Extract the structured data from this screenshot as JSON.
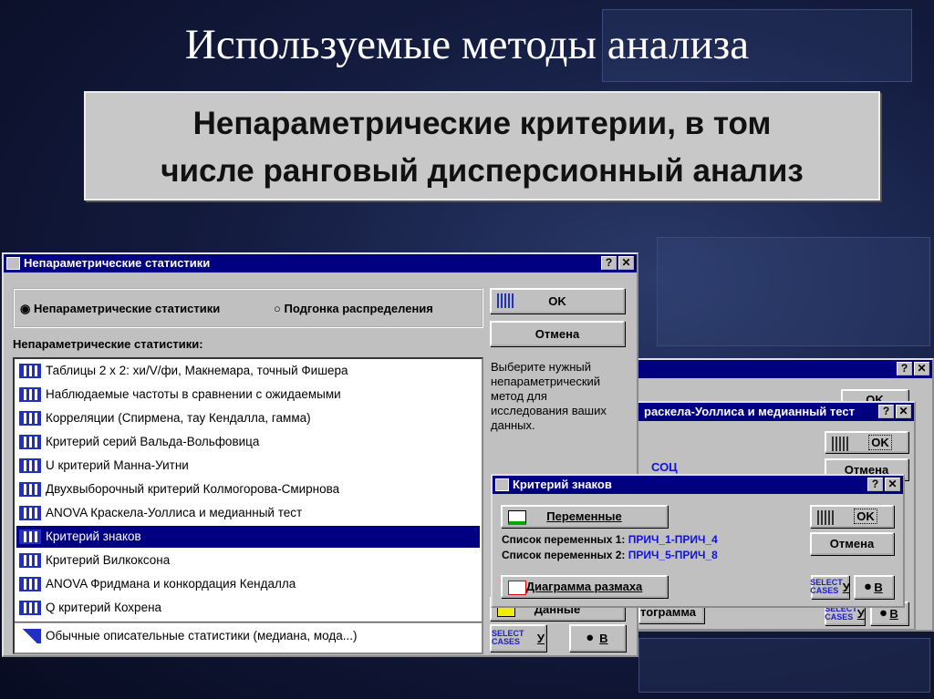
{
  "slide": {
    "title": "Используемые методы анализа",
    "subtitle_line1": "Непараметрические критерии, в том",
    "subtitle_line2": "числе ранговый дисперсионный анализ"
  },
  "main_dialog": {
    "title": "Непараметрические статистики",
    "radio_options": [
      {
        "label": "Непараметрические статистики",
        "selected": true
      },
      {
        "label": "Подгонка распределения",
        "selected": false
      }
    ],
    "list_label": "Непараметрические статистики:",
    "items": [
      "Таблицы 2 x 2:  хи/V/фи, Макнемара, точный Фишера",
      "Наблюдаемые частоты в сравнении с ожидаемыми",
      "Корреляции (Спирмена, тау Кендалла, гамма)",
      "Критерий серий Вальда-Вольфовица",
      "U критерий Манна-Уитни",
      "Двухвыборочный критерий Колмогорова-Смирнова",
      "ANOVA Краскела-Уоллиса и медианный тест",
      "Критерий знаков",
      "Критерий Вилкоксона",
      "ANOVA Фридмана и конкордация Кендалла",
      "Q критерий Кохрена"
    ],
    "selected_item": "Критерий знаков",
    "extra_item": "Обычные описательные статистики (медиана, мода...)",
    "ok": "OK",
    "cancel": "Отмена",
    "help_text": "Выберите нужный непараметрический метод для исследования ваших данных.",
    "data_button": "Данные",
    "select_cases": "SELECT CASES",
    "select_key": "У",
    "weight_key": "В",
    "help": "?",
    "close": "✕"
  },
  "back_dialog": {
    "ok": "OK"
  },
  "kw_dialog": {
    "title": "раскела-Уоллиса и медианный тест",
    "ok": "OK",
    "cancel": "Отмена",
    "var_text": "СОЦ",
    "hist_button": "тограмма",
    "select_cases": "SELECT CASES",
    "select_key": "У",
    "weight_key": "В"
  },
  "sign_dialog": {
    "title": "Критерий знаков",
    "variables_button": "Переменные",
    "list1_label": "Список переменных 1:",
    "list1_value": "ПРИЧ_1-ПРИЧ_4",
    "list2_label": "Список переменных 2:",
    "list2_value": "ПРИЧ_5-ПРИЧ_8",
    "boxplot_button": "Диаграмма размаха",
    "ok": "OK",
    "cancel": "Отмена",
    "select_cases": "SELECT CASES",
    "select_key": "У",
    "weight_key": "В"
  }
}
